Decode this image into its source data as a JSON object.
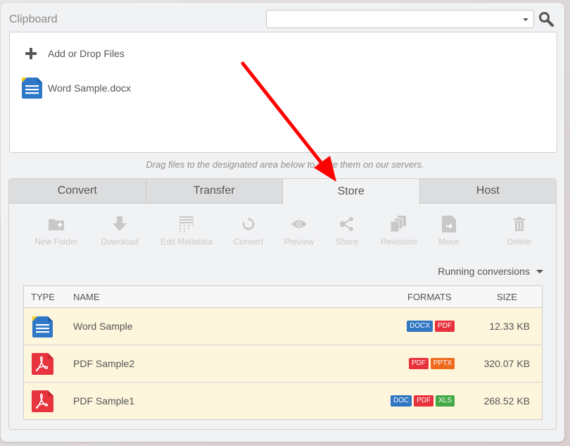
{
  "clipboard": {
    "title": "Clipboard",
    "select_value": "",
    "add_files_label": "Add or Drop Files",
    "files": [
      {
        "name": "Word Sample.docx",
        "icon": "word-doc-icon"
      }
    ]
  },
  "hint": "Drag files to the designated area below to store them on our servers.",
  "tabs": [
    {
      "label": "Convert",
      "active": false
    },
    {
      "label": "Transfer",
      "active": false
    },
    {
      "label": "Store",
      "active": true
    },
    {
      "label": "Host",
      "active": false
    }
  ],
  "toolbar": [
    {
      "label": "New Folder",
      "icon": "new-folder-icon"
    },
    {
      "label": "Download",
      "icon": "download-icon"
    },
    {
      "label": "Edit Metadata",
      "icon": "metadata-icon"
    },
    {
      "label": "Convert",
      "icon": "convert-icon"
    },
    {
      "label": "Preview",
      "icon": "eye-icon"
    },
    {
      "label": "Share",
      "icon": "share-icon"
    },
    {
      "label": "Revisions",
      "icon": "revisions-icon"
    },
    {
      "label": "Move",
      "icon": "move-icon"
    },
    {
      "label": "Delete",
      "icon": "trash-icon"
    }
  ],
  "running_conversions_label": "Running conversions",
  "table": {
    "headers": {
      "type": "TYPE",
      "name": "NAME",
      "formats": "FORMATS",
      "size": "SIZE"
    },
    "rows": [
      {
        "type": "word",
        "name": "Word Sample",
        "formats": [
          "DOCX",
          "PDF"
        ],
        "size": "12.33 KB"
      },
      {
        "type": "pdf",
        "name": "PDF Sample2",
        "formats": [
          "PDF",
          "PPTX"
        ],
        "size": "320.07 KB"
      },
      {
        "type": "pdf",
        "name": "PDF Sample1",
        "formats": [
          "DOC",
          "PDF",
          "XLS"
        ],
        "size": "268.52 KB"
      }
    ]
  },
  "format_colors": {
    "DOCX": "#2f76c3",
    "DOC": "#2f76c3",
    "PDF": "#e8313c",
    "PPTX": "#ee6a1f",
    "XLS": "#43a944"
  },
  "colors": {
    "annotation_arrow": "#ff0000",
    "word_blue": "#2f78c8",
    "pdf_red": "#e8343e"
  }
}
